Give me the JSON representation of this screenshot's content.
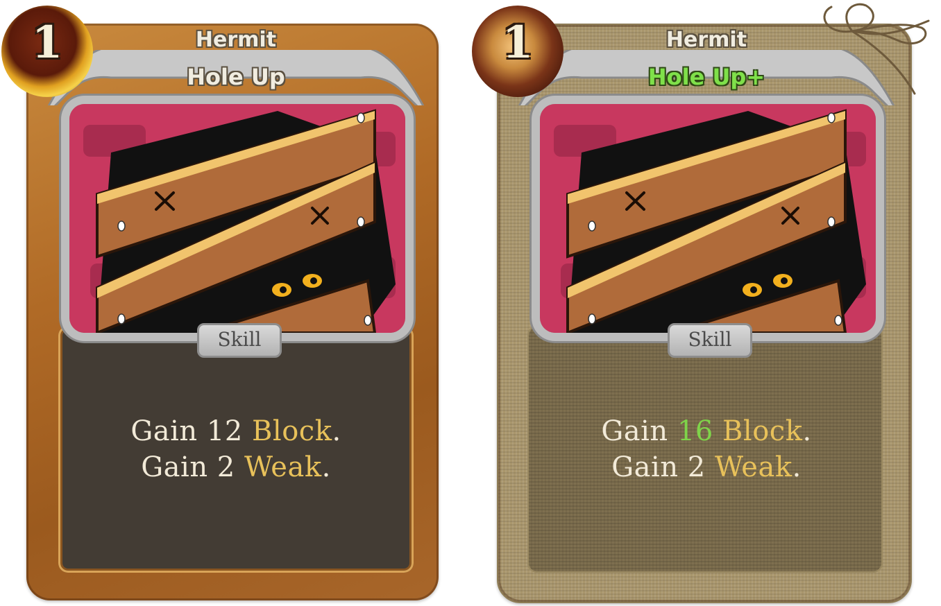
{
  "cards": [
    {
      "cost": "1",
      "character": "Hermit",
      "name": "Hole Up",
      "type": "Skill",
      "line1": {
        "a": "Gain ",
        "num": "12",
        "b": " ",
        "kw": "Block",
        "c": "."
      },
      "line2": {
        "a": "Gain 2 ",
        "kw": "Weak",
        "b": "."
      },
      "frame": "wood"
    },
    {
      "cost": "1",
      "character": "Hermit",
      "name": "Hole Up+",
      "type": "Skill",
      "line1": {
        "a": "Gain ",
        "num": "16",
        "b": " ",
        "kw": "Block",
        "c": "."
      },
      "line2": {
        "a": "Gain 2 ",
        "kw": "Weak",
        "b": "."
      },
      "frame": "burlap"
    }
  ],
  "colors": {
    "keyword": "#e8c15a",
    "upgraded": "#7fd44a",
    "desc_bg": "#433c34",
    "wood": "#b06a26",
    "burlap": "#a9966c"
  }
}
